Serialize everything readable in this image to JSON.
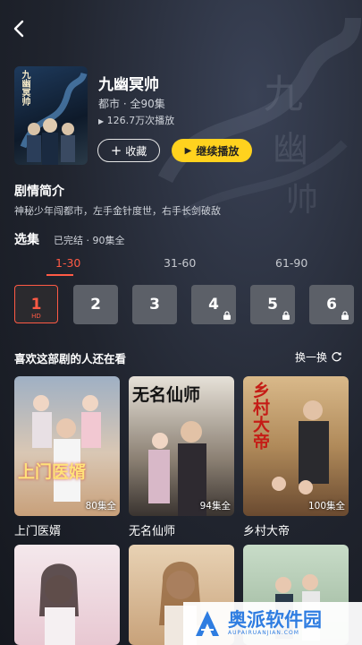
{
  "header": {
    "back_icon": "chevron-left-icon"
  },
  "show": {
    "title": "九幽冥帅",
    "meta": "都市 · 全90集",
    "plays": "126.7万次播放",
    "fav_label": "收藏",
    "play_label": "继续播放",
    "poster_text": "九幽冥帅"
  },
  "synopsis": {
    "heading": "剧情简介",
    "text": "神秘少年闯都市，左手金针度世，右手长剑破敌"
  },
  "episodes": {
    "heading": "选集",
    "status": "已完结 · 90集全",
    "ranges": [
      "1-30",
      "31-60",
      "61-90"
    ],
    "active_range": 0,
    "items": [
      {
        "label": "1",
        "sub": "HD",
        "selected": true,
        "locked": false
      },
      {
        "label": "2",
        "selected": false,
        "locked": false
      },
      {
        "label": "3",
        "selected": false,
        "locked": false
      },
      {
        "label": "4",
        "selected": false,
        "locked": true
      },
      {
        "label": "5",
        "selected": false,
        "locked": true
      },
      {
        "label": "6",
        "selected": false,
        "locked": true
      }
    ]
  },
  "recommend": {
    "heading": "喜欢这部剧的人还在看",
    "refresh_label": "换一换",
    "cards": [
      {
        "title": "上门医婿",
        "badge": "80集全",
        "poster_text": "上门医婿"
      },
      {
        "title": "无名仙师",
        "badge": "94集全",
        "poster_text": "无名仙师"
      },
      {
        "title": "乡村大帝",
        "badge": "100集全",
        "poster_text": "乡村大帝"
      }
    ]
  },
  "watermark": {
    "text": "奥派软件园",
    "url": "AUPAIRUANJIAN.COM"
  },
  "colors": {
    "accent": "#ff5a45",
    "play_button": "#ffd21e",
    "background": "#20242e"
  }
}
